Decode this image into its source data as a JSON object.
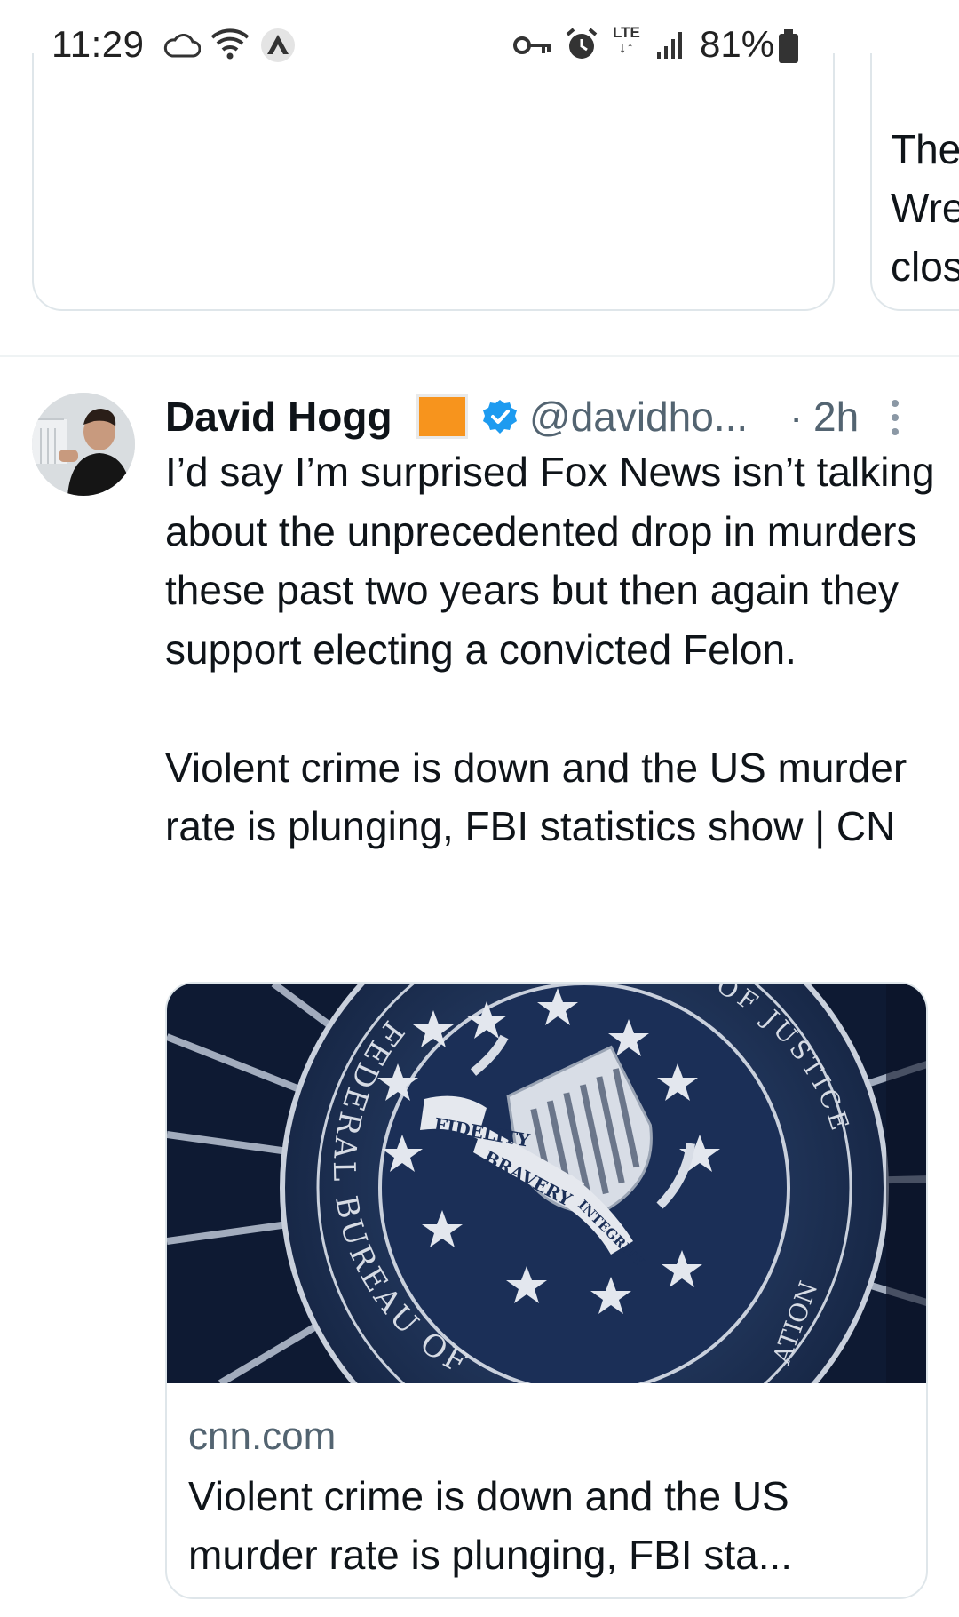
{
  "status_bar": {
    "time": "11:29",
    "network": "LTE",
    "battery": "81%",
    "icons": [
      "cloud-icon",
      "wifi-icon",
      "vpn-icon",
      "key-icon",
      "alarm-icon",
      "signal-icon",
      "battery-icon"
    ]
  },
  "previous_tweet_card": {
    "lines": [
      "The",
      "Wre",
      "clos"
    ]
  },
  "tweet": {
    "author_name": "David Hogg",
    "handle": "@davidho...",
    "separator": "·",
    "time": "2h",
    "text": "I’d say I’m surprised Fox News isn’t talking about the unprecedented drop in murders these past two years but then again they support electing a convicted Felon.\n\nViolent crime is down and the US murder rate is plunging, FBI statistics show | CN",
    "link_card": {
      "domain": "cnn.com",
      "title": "Violent crime is down and the US murder rate is plunging, FBI sta...",
      "image_text": {
        "ring_left": "FEDERAL BUREAU OF",
        "ring_top": "MENT OF JUSTICE",
        "ring_bottom": "ATION",
        "ribbon_1": "FIDELITY",
        "ribbon_2": "BRAVERY",
        "ribbon_3": "INTEGRITY"
      }
    }
  },
  "colors": {
    "text_primary": "#0f1419",
    "text_secondary": "#536471",
    "verified_blue": "#1d9bf0",
    "flag_orange": "#f7941d",
    "border": "#dfe6ea"
  }
}
